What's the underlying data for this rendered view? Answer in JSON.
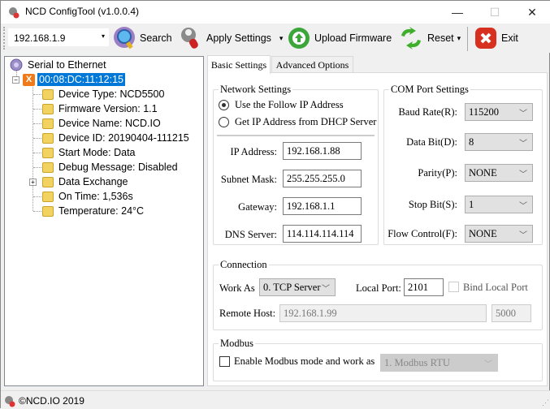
{
  "window": {
    "title": "NCD ConfigTool (v1.0.0.4)",
    "minimize": "—",
    "maximize": "☐",
    "close": "✕"
  },
  "toolbar": {
    "ip_combo_value": "192.168.1.9",
    "search_label": "Search",
    "apply_settings_label": "Apply Settings",
    "upload_firmware_label": "Upload Firmware",
    "reset_label": "Reset",
    "exit_label": "Exit",
    "dropdown_arrow": "▾"
  },
  "tree": {
    "root": "Serial to Ethernet",
    "device_mac": "00:08:DC:11:12:15",
    "device_badge": "X",
    "children": [
      "Device Type: NCD5500",
      "Firmware Version: 1.1",
      "Device Name: NCD.IO",
      "Device ID: 20190404-111215",
      "Start Mode: Data",
      "Debug Message: Disabled",
      "Data Exchange",
      "On Time: 1,536s",
      "Temperature: 24°C"
    ],
    "expand_collapse": "−",
    "expand": "+"
  },
  "tabs": {
    "basic": "Basic Settings",
    "advanced": "Advanced Options"
  },
  "network": {
    "legend": "Network Settings",
    "radio_static": "Use the Follow IP Address",
    "radio_dhcp": "Get IP Address from DHCP Server",
    "ip_label": "IP Address:",
    "ip_value": "192.168.1.88",
    "mask_label": "Subnet Mask:",
    "mask_value": "255.255.255.0",
    "gateway_label": "Gateway:",
    "gateway_value": "192.168.1.1",
    "dns_label": "DNS Server:",
    "dns_value": "114.114.114.114"
  },
  "com": {
    "legend": "COM Port Settings",
    "baud_label": "Baud Rate(R):",
    "baud_value": "115200",
    "databit_label": "Data Bit(D):",
    "databit_value": "8",
    "parity_label": "Parity(P):",
    "parity_value": "NONE",
    "stopbit_label": "Stop Bit(S):",
    "stopbit_value": "1",
    "flow_label": "Flow Control(F):",
    "flow_value": "NONE"
  },
  "connection": {
    "legend": "Connection",
    "work_as_label": "Work As",
    "work_as_value": "0. TCP Server",
    "local_port_label": "Local Port:",
    "local_port_value": "2101",
    "bind_local_port_label": "Bind Local Port",
    "remote_host_label": "Remote Host:",
    "remote_host_value": "192.168.1.99",
    "remote_port_value": "5000"
  },
  "modbus": {
    "legend": "Modbus",
    "enable_label": "Enable Modbus mode and work as",
    "mode_value": "1. Modbus RTU"
  },
  "status": {
    "text": "©NCD.IO 2019"
  },
  "chevron": "﹀"
}
